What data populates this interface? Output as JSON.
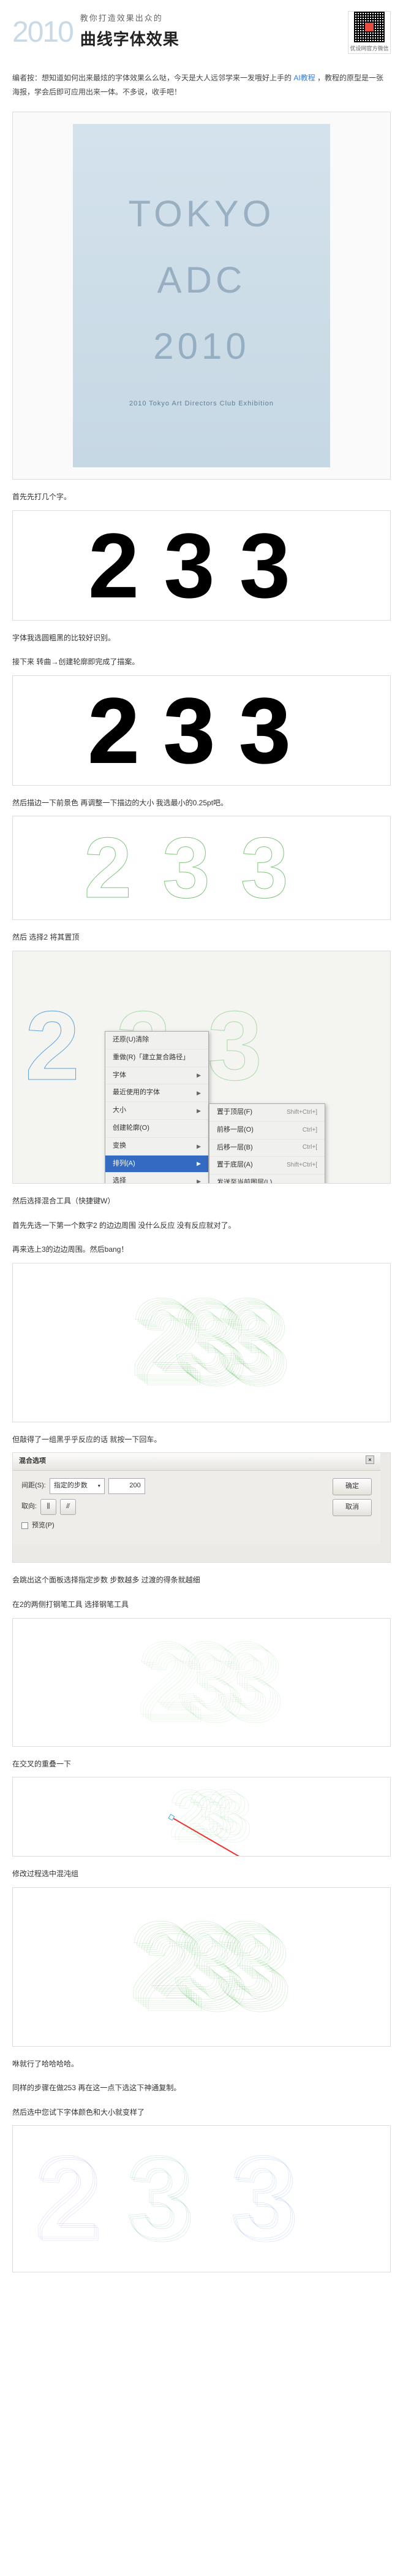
{
  "header": {
    "year": "2010",
    "title_small": "教你打造效果出众的",
    "title_large": "曲线字体效果",
    "qr_label": "优设网官方微信"
  },
  "intro": {
    "text_before": "编者按：想知道如何出来最炫的字体效果么么哒，今天是大人远邻学来一发哦好上手的",
    "link_text": "AI教程",
    "text_after": "，教程的原型是一张海报，学会后即可应用出来一体。不多说，收手吧！"
  },
  "poster": {
    "row1": "TOKYO",
    "row2": "ADC",
    "row3": "2010",
    "caption": "2010 Tokyo Art Directors Club Exhibition"
  },
  "steps": {
    "s1": "首先先打几个字。",
    "num_233": "233",
    "s2": "字体我选圆粗黑的比较好识别。",
    "s3": "接下来 转曲→创建轮廓即完成了描案。",
    "s4": "然后描边一下前景色 再调整一下描边的大小 我选最小的0.25pt吧。",
    "s5": "然后 选择2 将其置顶",
    "s6": "然后选择混合工具（快捷键W）",
    "s7": "首先先选一下第一个数字2 的边边周围 没什么反应 没有反应就对了。",
    "s8": "再来选上3的边边周围。然后bang！",
    "s9": "但敲得了一组黑乎乎反应的话 就按一下回车。",
    "s10": "会跳出这个面板选择指定步数 步数越多 过渡的得条就越细",
    "s11": "在2的两侧打钢笔工具 选择钢笔工具",
    "s12": "在交叉的重叠一下",
    "s13": "修改过程选中混沌组",
    "s14": "咻就行了哈哈哈哈。",
    "s15": "同样的步骤在做253 再在这一点下选这下神通复制。",
    "s16": "然后选中您试下字体颜色和大小就变样了"
  },
  "context_menu": {
    "items": [
      "还原(U)清除",
      "重做(R)「建立复合路径」",
      "字体",
      "最近使用的字体",
      "大小",
      "创建轮廓(O)",
      "变换",
      "排列(A)",
      "选择"
    ],
    "submenu": [
      {
        "label": "置于顶层(F)",
        "shortcut": "Shift+Ctrl+]"
      },
      {
        "label": "前移一层(O)",
        "shortcut": "Ctrl+]"
      },
      {
        "label": "后移一层(B)",
        "shortcut": "Ctrl+["
      },
      {
        "label": "置于底层(A)",
        "shortcut": "Shift+Ctrl+["
      },
      {
        "label": "发送至当前图层(L)",
        "shortcut": ""
      }
    ]
  },
  "dialog": {
    "title": "混合选项",
    "spacing_label": "间距(S):",
    "spacing_value_label": "指定的步数",
    "spacing_count": "200",
    "orient_label": "取向:",
    "preview_label": "预览(P)",
    "ok": "确定",
    "cancel": "取消"
  }
}
